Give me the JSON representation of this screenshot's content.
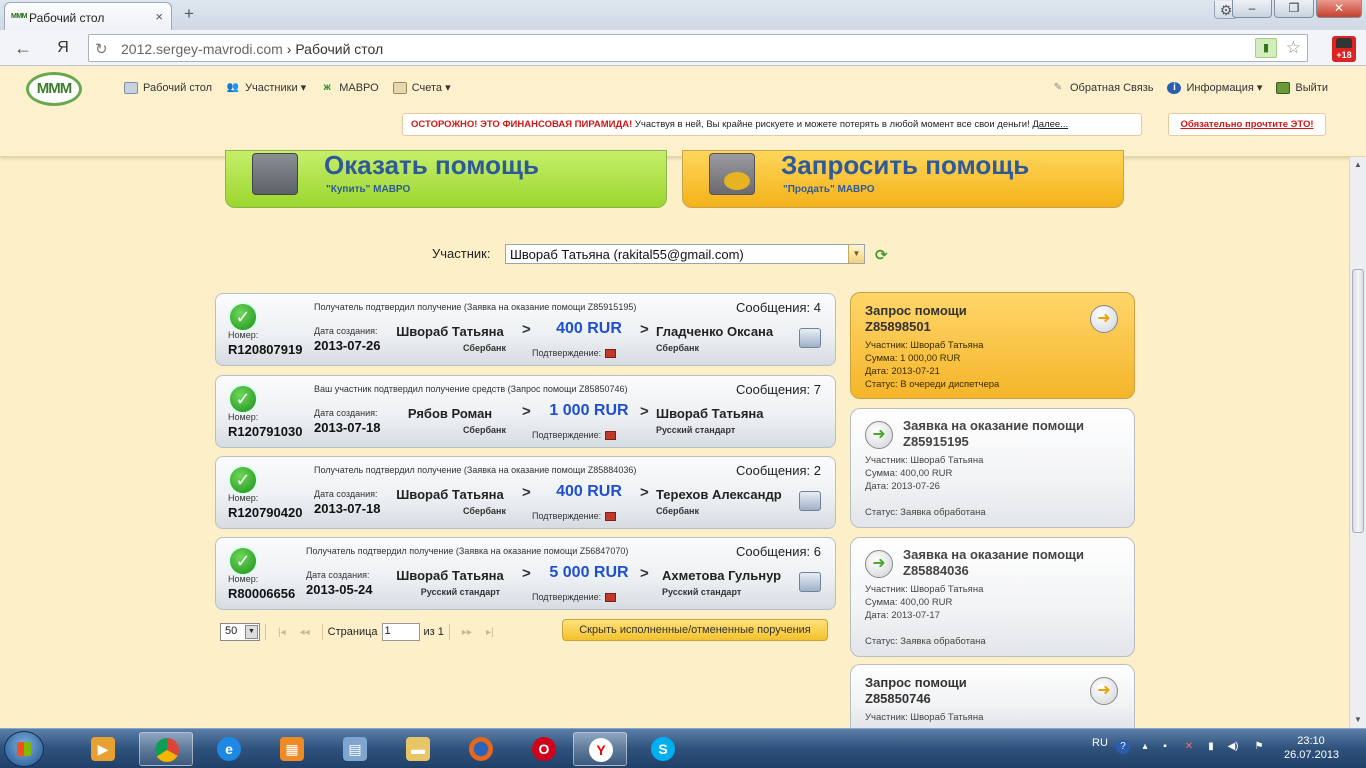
{
  "browser": {
    "tab_title": "Рабочий стол",
    "favicon_text": "MMM",
    "url_domain": "2012.sergey-mavrodi.com",
    "url_sep": "›",
    "url_page": "Рабочий стол",
    "ext_badge": "+18",
    "yandex_letter": "Я"
  },
  "nav": {
    "logo": "МММ",
    "items": [
      {
        "label": "Рабочий стол",
        "icon": "desktop-icon"
      },
      {
        "label": "Участники ▾",
        "icon": "users-icon"
      },
      {
        "label": "МАВРО",
        "icon": "mavro-icon"
      },
      {
        "label": "Счета ▾",
        "icon": "accounts-icon"
      }
    ],
    "right": [
      {
        "label": "Обратная Связь",
        "icon": "feedback-icon"
      },
      {
        "label": "Информация ▾",
        "icon": "info-icon"
      },
      {
        "label": "Выйти",
        "icon": "logout-icon"
      }
    ]
  },
  "warning": {
    "red": "ОСТОРОЖНО! ЭТО ФИНАНСОВАЯ ПИРАМИДА!",
    "text": " Участвуя в ней, Вы крайне рискуете и можете потерять в любой момент все свои деньги! ",
    "link": "Далее...",
    "must_read": "Обязательно прочтите ЭТО!"
  },
  "help": {
    "give_title": "Оказать помощь",
    "give_sub": "\"Купить\" МАВРО",
    "ask_title": "Запросить помощь",
    "ask_sub": "\"Продать\" МАВРО"
  },
  "participant": {
    "label": "Участник:",
    "value": "Швораб Татьяна (rakital55@gmail.com)"
  },
  "orders": [
    {
      "message": "Получатель подтвердил получение (Заявка на оказание помощи Z85915195)",
      "count": "Сообщения: 4",
      "number_label": "Номер:",
      "number": "R120807919",
      "date_label": "Дата создания:",
      "date": "2013-07-26",
      "from": "Швораб Татьяна",
      "from_bank": "Сбербанк",
      "amount": "400 RUR",
      "confirm": "Подтверждение:",
      "to": "Гладченко Оксана",
      "to_bank": "Сбербанк",
      "printer": true
    },
    {
      "message": "Ваш участник подтвердил получение средств (Запрос помощи Z85850746)",
      "count": "Сообщения: 7",
      "number_label": "Номер:",
      "number": "R120791030",
      "date_label": "Дата создания:",
      "date": "2013-07-18",
      "from": "Рябов Роман",
      "from_bank": "Сбербанк",
      "amount": "1 000 RUR",
      "confirm": "Подтверждение:",
      "to": "Швораб Татьяна",
      "to_bank": "Русский стандарт",
      "printer": false
    },
    {
      "message": "Получатель подтвердил получение (Заявка на оказание помощи Z85884036)",
      "count": "Сообщения: 2",
      "number_label": "Номер:",
      "number": "R120790420",
      "date_label": "Дата создания:",
      "date": "2013-07-18",
      "from": "Швораб Татьяна",
      "from_bank": "Сбербанк",
      "amount": "400 RUR",
      "confirm": "Подтверждение:",
      "to": "Терехов Александр",
      "to_bank": "Сбербанк",
      "printer": true
    },
    {
      "message": "Получатель подтвердил получение (Заявка на оказание помощи Z56847070)",
      "count": "Сообщения: 6",
      "number_label": "Номер:",
      "number": "R80006656",
      "date_label": "Дата создания:",
      "date": "2013-05-24",
      "from": "Швораб Татьяна",
      "from_bank": "Русский стандарт",
      "amount": "5 000 RUR",
      "confirm": "Подтверждение:",
      "to": "Ахметова Гульнур",
      "to_bank": "Русский стандарт",
      "printer": true
    }
  ],
  "pager": {
    "per_page": "50",
    "page_label": "Страница",
    "page": "1",
    "of": "из 1",
    "hide_button": "Скрыть исполненные/отмененные поручения"
  },
  "requests": [
    {
      "title": "Запрос помощи",
      "number": "Z85898501",
      "lines": [
        "Участник: Швораб Татьяна",
        "Сумма: 1 000,00 RUR",
        "Дата: 2013-07-21",
        "Статус: В очереди диспетчера"
      ],
      "active": true
    },
    {
      "title": "Заявка на оказание помощи",
      "number": "Z85915195",
      "lines": [
        "Участник: Швораб Татьяна",
        "Сумма: 400,00 RUR",
        "Дата: 2013-07-26",
        "Статус: Заявка обработана"
      ],
      "active": false
    },
    {
      "title": "Заявка на оказание помощи",
      "number": "Z85884036",
      "lines": [
        "Участник: Швораб Татьяна",
        "Сумма: 400,00 RUR",
        "Дата: 2013-07-17",
        "Статус: Заявка обработана"
      ],
      "active": false
    },
    {
      "title": "Запрос помощи",
      "number": "Z85850746",
      "lines": [
        "Участник: Швораб Татьяна"
      ],
      "active": false
    }
  ],
  "taskbar": {
    "lang": "RU",
    "time": "23:10",
    "date": "26.07.2013"
  }
}
